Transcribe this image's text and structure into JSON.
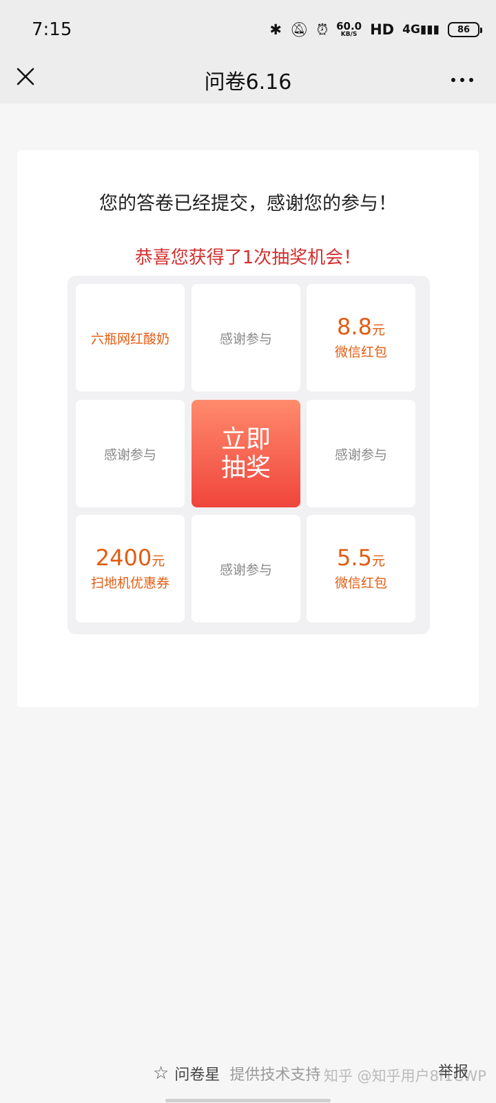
{
  "status_bar": {
    "time": "7:15",
    "net_speed": "60.0",
    "net_unit": "KB/S",
    "hd": "HD",
    "signal": "4G",
    "battery": "86"
  },
  "nav": {
    "title": "问卷6.16",
    "close_icon": "close-icon",
    "more_icon": "more-icon"
  },
  "card": {
    "thanks": "您的答卷已经提交，感谢您的参与！",
    "congrats": "恭喜您获得了1次抽奖机会！"
  },
  "lottery": {
    "cells": {
      "c1": {
        "text": "六瓶网红酸奶"
      },
      "c2": {
        "text": "感谢参与"
      },
      "c3": {
        "amount": "8.8",
        "unit": "元",
        "sub": "微信红包"
      },
      "c4": {
        "text": "感谢参与"
      },
      "c6": {
        "text": "感谢参与"
      },
      "c7": {
        "amount": "2400",
        "unit": "元",
        "sub": "扫地机优惠券"
      },
      "c8": {
        "text": "感谢参与"
      },
      "c9": {
        "amount": "5.5",
        "unit": "元",
        "sub": "微信红包"
      }
    },
    "draw_button": {
      "line1": "立即",
      "line2": "抽奖"
    }
  },
  "footer": {
    "brand": "问卷星",
    "support": "提供技术支持",
    "report": "举报",
    "watermark": "知乎 @知乎用户8f1CWP"
  },
  "colors": {
    "accent_red": "#d32f2f",
    "prize_orange": "#e25c12",
    "button_gradient_top": "#ff8a6c",
    "button_gradient_bottom": "#f0453c"
  }
}
